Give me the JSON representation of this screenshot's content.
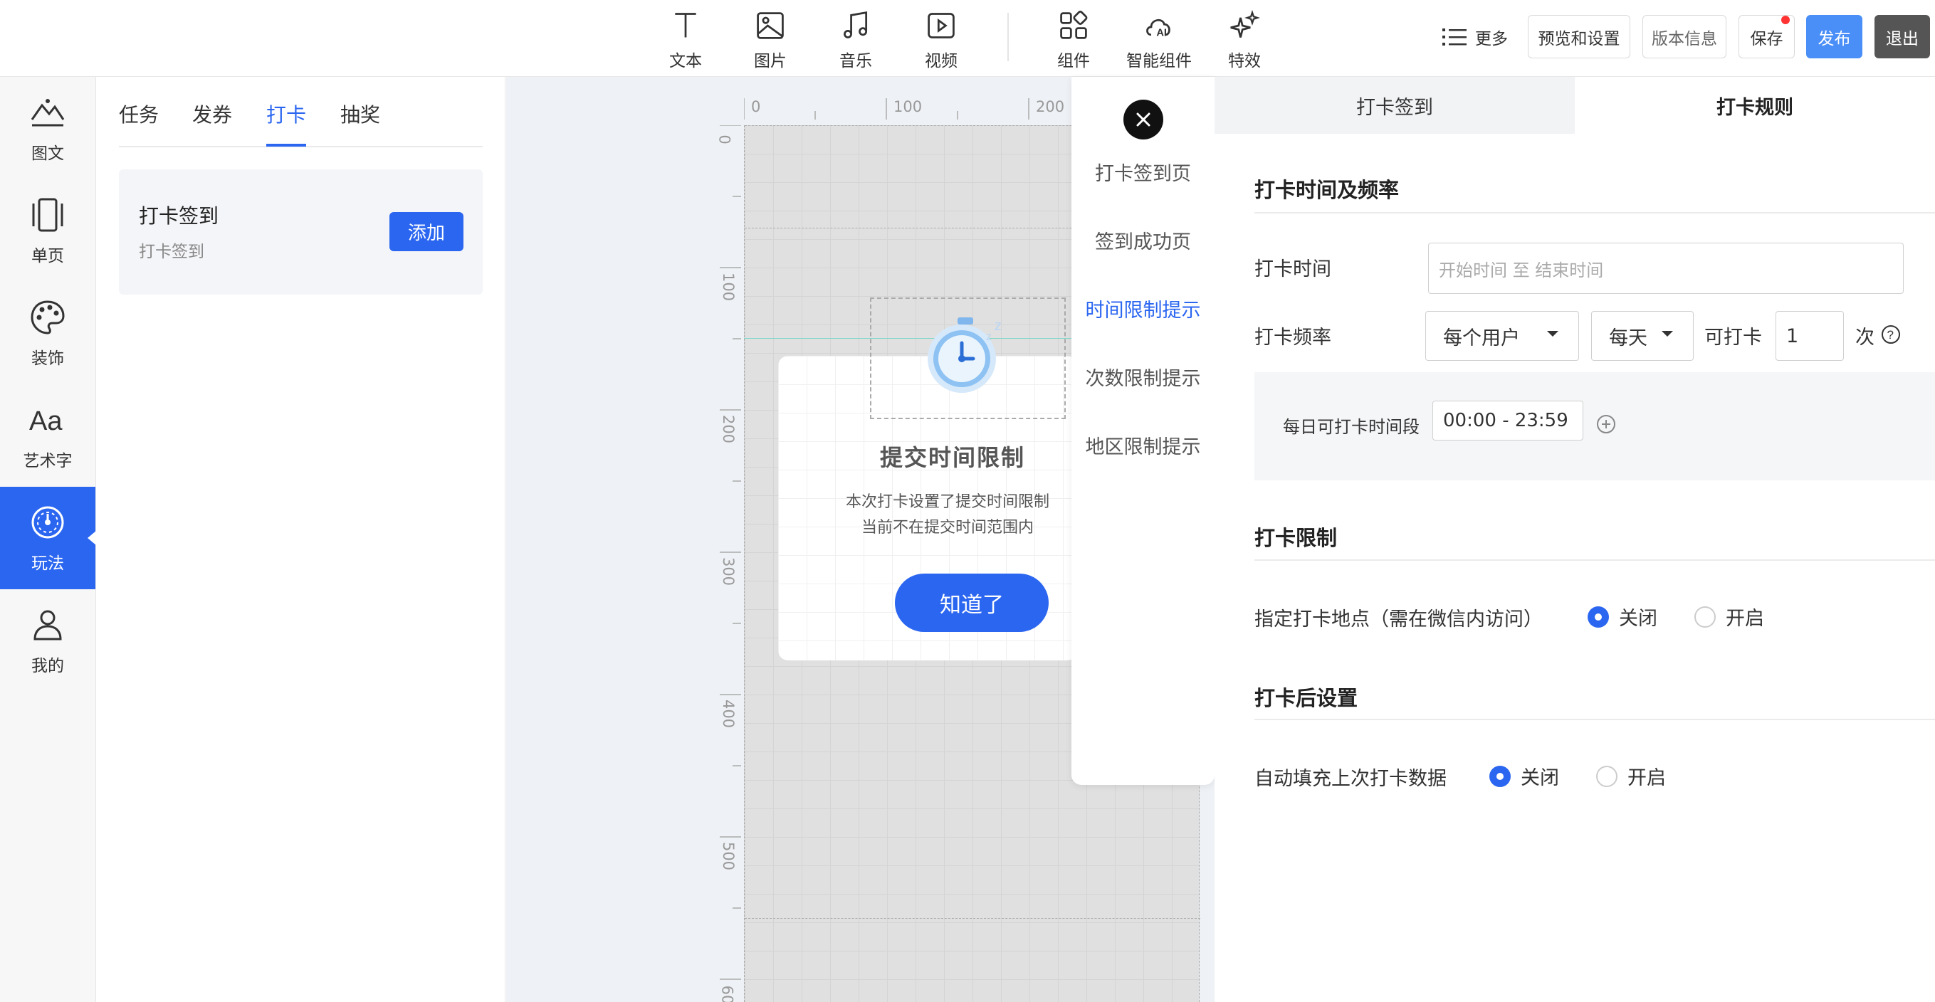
{
  "toolbar": {
    "tools": [
      {
        "icon": "text-icon",
        "label": "文本"
      },
      {
        "icon": "image-icon",
        "label": "图片"
      },
      {
        "icon": "music-icon",
        "label": "音乐"
      },
      {
        "icon": "video-icon",
        "label": "视频"
      },
      {
        "icon": "component-icon",
        "label": "组件"
      },
      {
        "icon": "ai-component-icon",
        "label": "智能组件"
      },
      {
        "icon": "effects-icon",
        "label": "特效"
      }
    ],
    "more_label": "更多",
    "preview_label": "预览和设置",
    "version_label": "版本信息",
    "save_label": "保存",
    "publish_label": "发布",
    "exit_label": "退出"
  },
  "sidebar": {
    "items": [
      {
        "icon": "image-text-icon",
        "label": "图文"
      },
      {
        "icon": "single-page-icon",
        "label": "单页"
      },
      {
        "icon": "palette-icon",
        "label": "装饰"
      },
      {
        "icon": "art-text-icon",
        "label": "艺术字"
      },
      {
        "icon": "gameplay-icon",
        "label": "玩法",
        "active": true
      },
      {
        "icon": "user-icon",
        "label": "我的"
      }
    ]
  },
  "panel": {
    "tabs": [
      "任务",
      "发券",
      "打卡",
      "抽奖"
    ],
    "active_tab": "打卡",
    "card": {
      "title": "打卡签到",
      "subtitle": "打卡签到",
      "button": "添加"
    }
  },
  "canvas": {
    "ruler_top": [
      "0",
      "100",
      "200"
    ],
    "ruler_left": [
      "0",
      "100",
      "200",
      "300",
      "400",
      "500",
      "60"
    ],
    "modal": {
      "title": "提交时间限制",
      "line1": "本次打卡设置了提交时间限制",
      "line2": "当前不在提交时间范围内",
      "button": "知道了"
    }
  },
  "page_list": {
    "items": [
      "打卡签到页",
      "签到成功页",
      "时间限制提示",
      "次数限制提示",
      "地区限制提示"
    ],
    "active": "时间限制提示"
  },
  "settings": {
    "tabs": [
      "打卡签到",
      "打卡规则"
    ],
    "active_tab": "打卡规则",
    "section1": {
      "title": "打卡时间及频率",
      "time_label": "打卡时间",
      "time_placeholder": "开始时间 至 结束时间",
      "freq_label": "打卡频率",
      "freq_user": "每个用户",
      "freq_period": "每天",
      "freq_can": "可打卡",
      "freq_count": "1",
      "freq_unit": "次",
      "daily_label": "每日可打卡时间段",
      "daily_value": "00:00 - 23:59"
    },
    "section2": {
      "title": "打卡限制",
      "location_label": "指定打卡地点（需在微信内访问）",
      "off": "关闭",
      "on": "开启",
      "value": "关闭"
    },
    "section3": {
      "title": "打卡后设置",
      "autofill_label": "自动填充上次打卡数据",
      "off": "关闭",
      "on": "开启",
      "value": "关闭"
    }
  },
  "colors": {
    "primary": "#2b66f0",
    "publish": "#4a8ef7",
    "exit": "#555555"
  }
}
